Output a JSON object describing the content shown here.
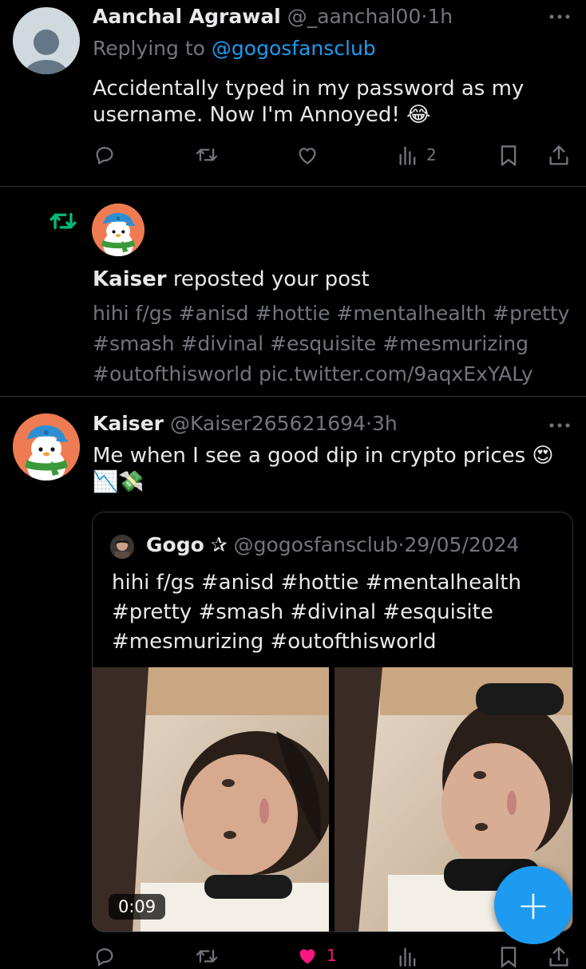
{
  "tweet1": {
    "author_name": "Aanchal Agrawal",
    "author_handle": "@_aanchal00",
    "separator": "·",
    "time": "1h",
    "replying_prefix": "Replying to",
    "replying_handle": "@gogosfansclub",
    "text": "Accidentally typed in my password as my username. Now I'm Annoyed! 😂",
    "stats": {
      "views": "2"
    },
    "icons": [
      "reply-icon",
      "repost-icon",
      "like-icon",
      "views-icon",
      "bookmark-icon",
      "share-icon",
      "more-icon"
    ]
  },
  "notification": {
    "actor": "Kaiser",
    "action_text": "reposted your post",
    "preview_text": "hihi f/gs #anisd #hottie #mentalhealth #pretty #smash #divinal #esquisite #mesmurizing #outofthisworld pic.twitter.com/9aqxExYALy",
    "accent_color": "#00ba7c"
  },
  "tweet2": {
    "author_name": "Kaiser",
    "author_handle": "@Kaiser265621694",
    "separator": "·",
    "time": "3h",
    "text": "Me when I see a good dip in crypto prices 😍",
    "text_emojis": "📉💸",
    "quote": {
      "author_name": "Gogo",
      "author_badge": "✰",
      "author_handle": "@gogosfansclub",
      "separator": "·",
      "date": "29/05/2024",
      "text": "hihi f/gs #anisd #hottie #mentalhealth #pretty #smash #divinal #esquisite #mesmurizing #outofthisworld",
      "media_duration": "0:09"
    },
    "stats": {
      "likes": "1"
    }
  },
  "fab": {
    "label": "+",
    "color": "#1d9bf0"
  }
}
